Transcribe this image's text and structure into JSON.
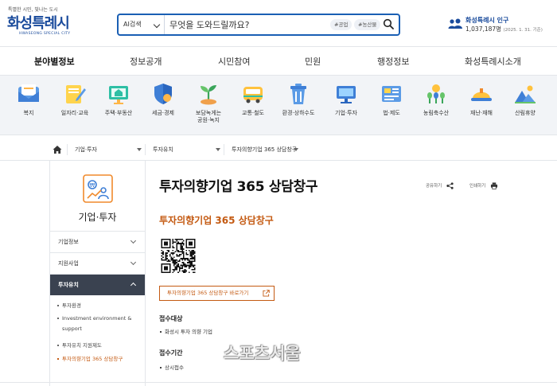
{
  "header": {
    "logo": {
      "slogan": "특별한 시민, 빛나는 도시",
      "name": "화성특례시",
      "sub": "HWASEONG SPECIAL CITY"
    },
    "search": {
      "scope": "AI검색",
      "placeholder": "무엇을 도와드릴까요?",
      "tags": [
        "#공업",
        "#농산물"
      ]
    },
    "population": {
      "title": "화성특례시 인구",
      "value": "1,037,187명",
      "as_of": "(2025. 1. 31. 기준)"
    }
  },
  "gnb": {
    "items": [
      "분야별정보",
      "정보공개",
      "시민참여",
      "민원",
      "행정정보",
      "화성특례시소개"
    ],
    "active": "분야별정보"
  },
  "categories": [
    {
      "label": "복지",
      "icon": "mail-icon"
    },
    {
      "label": "일자리·교육",
      "icon": "notebook-pencil-icon"
    },
    {
      "label": "주택·부동산",
      "icon": "house-board-icon"
    },
    {
      "label": "세금·경제",
      "icon": "shield-icon"
    },
    {
      "label": "보담녹게는",
      "label2": "공원·녹지",
      "icon": "sprout-icon"
    },
    {
      "label": "교통·철도",
      "icon": "bus-icon"
    },
    {
      "label": "환경·상하수도",
      "icon": "trash-icon"
    },
    {
      "label": "기업·투자",
      "icon": "monitor-icon"
    },
    {
      "label": "법·제도",
      "icon": "document-icon"
    },
    {
      "label": "농림축수산",
      "icon": "crops-icon"
    },
    {
      "label": "재난·재해",
      "icon": "helmet-icon"
    },
    {
      "label": "산림휴양",
      "icon": "mountain-icon"
    }
  ],
  "breadcrumb": {
    "items": [
      "기업·투자",
      "투자유치",
      "투자의향기업 365 상담창구"
    ]
  },
  "sidebar": {
    "title": "기업·투자",
    "menus": [
      {
        "label": "기업정보"
      },
      {
        "label": "지원사업"
      },
      {
        "label": "투자유치"
      }
    ],
    "active_menu": "투자유치",
    "submenus": [
      "투자환경",
      "Investment environment & support",
      "투자유치 지원제도",
      "투자의향기업 365 상담창구"
    ],
    "active_submenu": "투자의향기업 365 상담창구"
  },
  "content": {
    "title": "투자의향기업 365 상담창구",
    "share_label": "공유하기",
    "print_label": "인쇄하기",
    "subtitle": "투자의향기업 365 상담창구",
    "link_button": "투자의향기업 365 상담창구 바로가기",
    "sections": [
      {
        "heading": "접수대상",
        "items": [
          "화성시 투자 의향 기업"
        ]
      },
      {
        "heading": "접수기간",
        "items": [
          "상시접수"
        ]
      }
    ]
  },
  "watermark": "스포츠서울",
  "colors": {
    "brand": "#1a4b9c",
    "search_border": "#1a5fb4",
    "accent_orange": "#c45a12",
    "active_menu_bg": "#3a4250"
  }
}
